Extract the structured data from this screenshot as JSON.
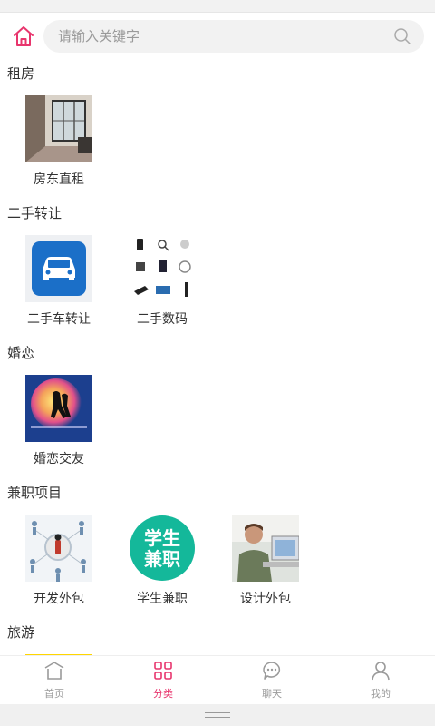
{
  "search": {
    "placeholder": "请输入关键字"
  },
  "sections": [
    {
      "title": "租房",
      "items": [
        {
          "label": "房东直租"
        }
      ]
    },
    {
      "title": "二手转让",
      "items": [
        {
          "label": "二手车转让",
          "badge": "二手车转让"
        },
        {
          "label": "二手数码"
        }
      ]
    },
    {
      "title": "婚恋",
      "items": [
        {
          "label": "婚恋交友"
        }
      ]
    },
    {
      "title": "兼职项目",
      "items": [
        {
          "label": "开发外包"
        },
        {
          "label": "学生兼职",
          "badge_line1": "学生",
          "badge_line2": "兼职"
        },
        {
          "label": "设计外包"
        }
      ]
    },
    {
      "title": "旅游"
    }
  ],
  "tabs": [
    {
      "label": "首页",
      "icon": "home-outline-icon"
    },
    {
      "label": "分类",
      "icon": "category-grid-icon"
    },
    {
      "label": "聊天",
      "icon": "chat-bubble-icon"
    },
    {
      "label": "我的",
      "icon": "user-icon"
    }
  ],
  "colors": {
    "accent": "#e8356d",
    "inactive": "#9a9a9a",
    "car_badge_blue": "#1b6fc8",
    "student_badge_teal": "#14b89a"
  }
}
